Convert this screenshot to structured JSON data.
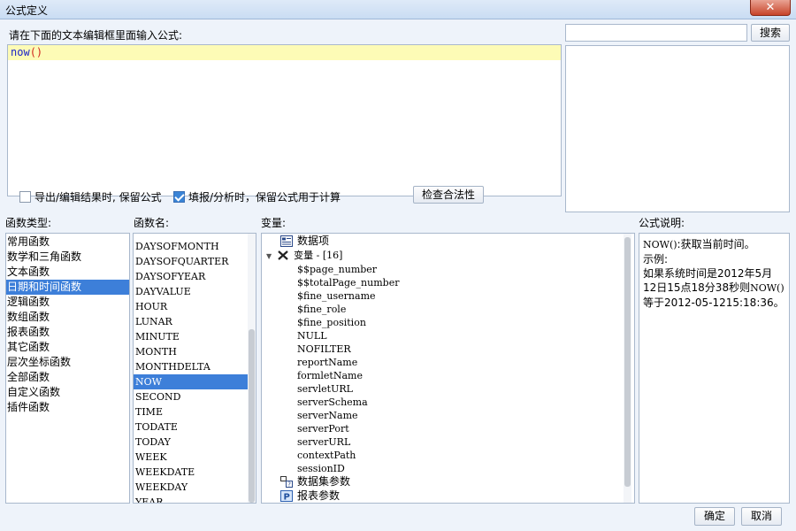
{
  "window": {
    "title": "公式定义",
    "close_glyph": "✕"
  },
  "editor": {
    "label": "请在下面的文本编辑框里面输入公式:",
    "fn_name": "now",
    "paren": "()"
  },
  "search": {
    "button": "搜索",
    "value": ""
  },
  "options": [
    {
      "label": "导出/编辑结果时, 保留公式",
      "checked": false
    },
    {
      "label": "填报/分析时，保留公式用于计算",
      "checked": true
    }
  ],
  "check_button": "检查合法性",
  "sections": {
    "func_type": "函数类型:",
    "func_name": "函数名:",
    "variables": "变量:",
    "description": "公式说明:"
  },
  "func_types": [
    "常用函数",
    "数学和三角函数",
    "文本函数",
    "日期和时间函数",
    "逻辑函数",
    "数组函数",
    "报表函数",
    "其它函数",
    "层次坐标函数",
    "全部函数",
    "自定义函数",
    "插件函数"
  ],
  "func_type_selected": 3,
  "func_names": [
    "DAYSOFMONTH",
    "DAYSOFQUARTER",
    "DAYSOFYEAR",
    "DAYVALUE",
    "HOUR",
    "LUNAR",
    "MINUTE",
    "MONTH",
    "MONTHDELTA",
    "NOW",
    "SECOND",
    "TIME",
    "TODATE",
    "TODAY",
    "WEEK",
    "WEEKDATE",
    "WEEKDAY",
    "YEAR"
  ],
  "func_name_selected": 9,
  "tree": {
    "data_items": "数据项",
    "variables_node": "变量 - [16]",
    "vars": [
      "$$page_number",
      "$$totalPage_number",
      "$fine_username",
      "$fine_role",
      "$fine_position",
      "NULL",
      "NOFILTER",
      "reportName",
      "formletName",
      "servletURL",
      "serverSchema",
      "serverName",
      "serverPort",
      "serverURL",
      "contextPath",
      "sessionID"
    ],
    "dataset_params": "数据集参数",
    "report_params": "报表参数"
  },
  "description": {
    "fn": "NOW()",
    "line1": ":获取当前时间。",
    "line2": "示例:",
    "line3": "如果系统时间是2012年5月12日15点18分38秒则",
    "line3_fn": "NOW()",
    "line3_end": "等于2012-05-1215:18:36。"
  },
  "footer": {
    "ok": "确定",
    "cancel": "取消"
  },
  "colors": {
    "selection": "#3d7fd9",
    "editor_line": "#fdfbb6"
  }
}
